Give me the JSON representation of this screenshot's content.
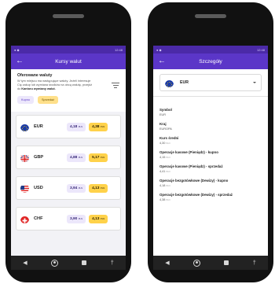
{
  "left_phone": {
    "status_text": "12:48",
    "title": "Kursy walut",
    "offer": {
      "title": "Oferowane waluty",
      "description_pre": "W tym miejscu ma następujące waluty. Jeżeli interesuje Cię zakup lub wymiana środków na obcą walutę, przejdź do ",
      "description_link": "Kantoru wymiany walut.",
      "buy_label": "Kupno",
      "sell_label": "Sprzedaż"
    },
    "currencies": [
      {
        "code": "EUR",
        "buy": "4,18",
        "sell": "4,38",
        "unit": "PLN",
        "icon": "eu-flag-icon"
      },
      {
        "code": "GBP",
        "buy": "4,88",
        "sell": "5,17",
        "unit": "PLN",
        "icon": "uk-flag-icon"
      },
      {
        "code": "USD",
        "buy": "3,94",
        "sell": "4,13",
        "unit": "PLN",
        "icon": "us-flag-icon"
      },
      {
        "code": "CHF",
        "buy": "3,90",
        "sell": "4,13",
        "unit": "PLN",
        "icon": "swiss-flag-icon"
      }
    ]
  },
  "right_phone": {
    "status_text": "12:48",
    "title": "Szczegóły",
    "selected_currency": "EUR",
    "details": [
      {
        "label": "Symbol",
        "value": "EUR",
        "unit": ""
      },
      {
        "label": "Kraj",
        "value": "EUROPA",
        "unit": ""
      },
      {
        "label": "Kurs średni",
        "value": "4,30",
        "unit": "PLN"
      },
      {
        "label": "Operacje kasowe (Pieniądz) - kupno",
        "value": "4,15",
        "unit": "PLN"
      },
      {
        "label": "Operacje kasowe (Pieniądz) - sprzedaż",
        "value": "4,41",
        "unit": "PLN"
      },
      {
        "label": "Operacje bezgotówkowe (Dewizy) - kupno",
        "value": "4,18",
        "unit": "PLN"
      },
      {
        "label": "Operacje bezgotówkowe (Dewizy) - sprzedaż",
        "value": "4,38",
        "unit": "PLN"
      }
    ]
  },
  "colors": {
    "primary": "#5b36c8",
    "status": "#4b2aa8",
    "accent_yellow": "#ffd24a",
    "chip_purple": "#ece7fb"
  }
}
